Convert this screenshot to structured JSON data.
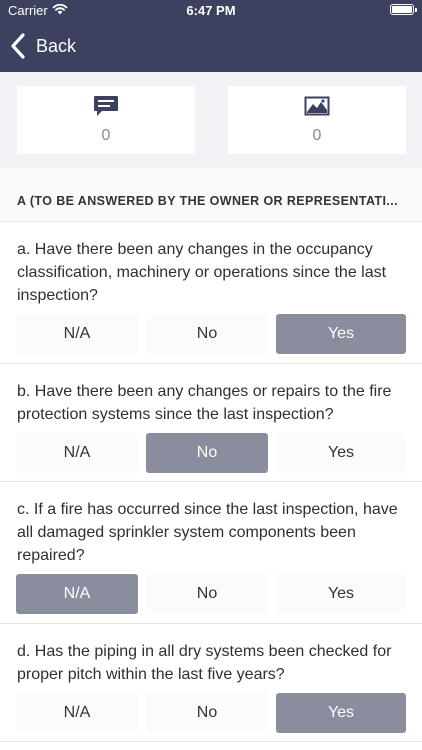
{
  "status_bar": {
    "carrier": "Carrier",
    "time": "6:47 PM"
  },
  "nav": {
    "back_label": "Back"
  },
  "stats": {
    "comments_count": "0",
    "images_count": "0"
  },
  "section": {
    "title": "A (TO BE ANSWERED BY THE OWNER OR REPRESENTATI..."
  },
  "options": {
    "na": "N/A",
    "no": "No",
    "yes": "Yes"
  },
  "questions": [
    {
      "text": "a. Have there been any changes in the occupancy classification, machinery or operations since the last inspection?",
      "selected": "Yes"
    },
    {
      "text": "b. Have there been any changes or repairs to the fire protection systems since the last inspection?",
      "selected": "No"
    },
    {
      "text": "c. If a fire has occurred since the last inspection, have all damaged sprinkler system components been repaired?",
      "selected": "N/A"
    },
    {
      "text": "d. Has the piping in all dry systems been checked for proper pitch within the last five years?",
      "selected": "Yes"
    }
  ],
  "colors": {
    "header": "#3c4160",
    "selected_option": "#8a8d9e"
  }
}
